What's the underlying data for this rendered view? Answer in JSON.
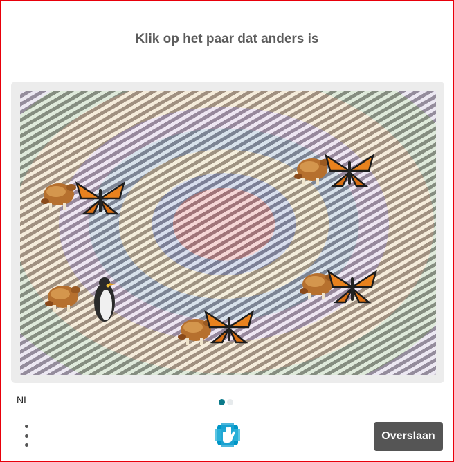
{
  "challenge": {
    "prompt": "Klik op het paar dat anders is",
    "pairs": [
      {
        "left": "roast-chicken-icon",
        "right": "monarch-butterfly-icon"
      },
      {
        "left": "roast-chicken-icon",
        "right": "monarch-butterfly-icon"
      },
      {
        "left": "roast-chicken-icon",
        "right": "penguin-icon"
      },
      {
        "left": "roast-chicken-icon",
        "right": "monarch-butterfly-icon"
      },
      {
        "left": "roast-chicken-icon",
        "right": "monarch-butterfly-icon"
      }
    ]
  },
  "footer": {
    "language": "NL",
    "page_indicator": {
      "current": 1,
      "total": 2
    },
    "skip_label": "Overslaan"
  },
  "colors": {
    "border": "#e8000b",
    "prompt_text": "#5c5c5c",
    "accent": "#0b7a8a",
    "skip_button": "#555555"
  }
}
